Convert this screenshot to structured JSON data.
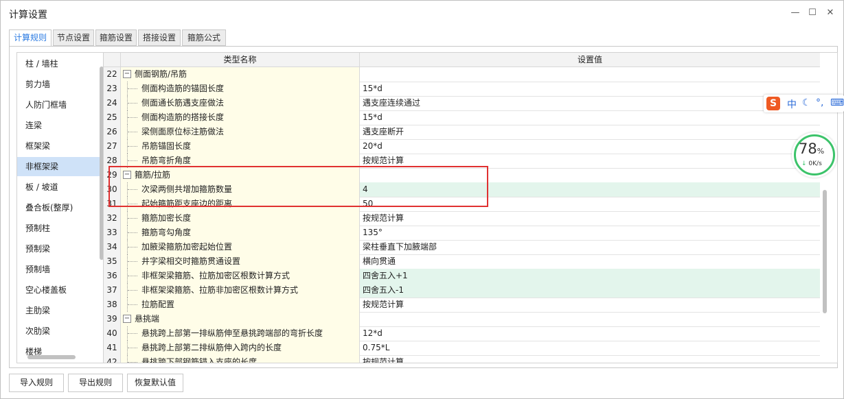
{
  "window": {
    "title": "计算设置",
    "controls": {
      "minimize": "—",
      "maximize": "☐",
      "close": "✕"
    }
  },
  "tabs": [
    {
      "label": "计算规则",
      "active": true
    },
    {
      "label": "节点设置",
      "active": false
    },
    {
      "label": "箍筋设置",
      "active": false
    },
    {
      "label": "搭接设置",
      "active": false
    },
    {
      "label": "箍筋公式",
      "active": false
    }
  ],
  "sidebar": {
    "items": [
      {
        "label": "柱 / 墙柱"
      },
      {
        "label": "剪力墙"
      },
      {
        "label": "人防门框墙"
      },
      {
        "label": "连梁"
      },
      {
        "label": "框架梁"
      },
      {
        "label": "非框架梁",
        "selected": true
      },
      {
        "label": "板 / 坡道"
      },
      {
        "label": "叠合板(整厚)"
      },
      {
        "label": "预制柱"
      },
      {
        "label": "预制梁"
      },
      {
        "label": "预制墙"
      },
      {
        "label": "空心楼盖板"
      },
      {
        "label": "主肋梁"
      },
      {
        "label": "次肋梁"
      },
      {
        "label": "楼梯"
      }
    ]
  },
  "grid": {
    "headers": {
      "name": "类型名称",
      "value": "设置值"
    },
    "rows": [
      {
        "num": "22",
        "name": "侧面钢筋/吊筋",
        "value": "",
        "group": true
      },
      {
        "num": "23",
        "name": "侧面构造筋的锚固长度",
        "value": "15*d"
      },
      {
        "num": "24",
        "name": "侧面通长筋遇支座做法",
        "value": "遇支座连续通过"
      },
      {
        "num": "25",
        "name": "侧面构造筋的搭接长度",
        "value": "15*d"
      },
      {
        "num": "26",
        "name": "梁侧面原位标注筋做法",
        "value": "遇支座断开"
      },
      {
        "num": "27",
        "name": "吊筋锚固长度",
        "value": "20*d"
      },
      {
        "num": "28",
        "name": "吊筋弯折角度",
        "value": "按规范计算"
      },
      {
        "num": "29",
        "name": "箍筋/拉筋",
        "value": "",
        "group": true
      },
      {
        "num": "30",
        "name": "次梁两侧共增加箍筋数量",
        "value": "4",
        "highlight": true
      },
      {
        "num": "31",
        "name": "起始箍筋距支座边的距离",
        "value": "50"
      },
      {
        "num": "32",
        "name": "箍筋加密长度",
        "value": "按规范计算"
      },
      {
        "num": "33",
        "name": "箍筋弯勾角度",
        "value": "135°"
      },
      {
        "num": "34",
        "name": "加腋梁箍筋加密起始位置",
        "value": "梁柱垂直下加腋端部"
      },
      {
        "num": "35",
        "name": "井字梁相交时箍筋贯通设置",
        "value": "横向贯通"
      },
      {
        "num": "36",
        "name": "非框架梁箍筋、拉筋加密区根数计算方式",
        "value": "四舍五入+1",
        "highlight": true
      },
      {
        "num": "37",
        "name": "非框架梁箍筋、拉筋非加密区根数计算方式",
        "value": "四舍五入-1",
        "highlight": true
      },
      {
        "num": "38",
        "name": "拉筋配置",
        "value": "按规范计算"
      },
      {
        "num": "39",
        "name": "悬挑端",
        "value": "",
        "group": true
      },
      {
        "num": "40",
        "name": "悬挑跨上部第一排纵筋伸至悬挑跨端部的弯折长度",
        "value": "12*d"
      },
      {
        "num": "41",
        "name": "悬挑跨上部第二排纵筋伸入跨内的长度",
        "value": "0.75*L"
      },
      {
        "num": "42",
        "name": "悬挑跨下部钢筋锚入支座的长度",
        "value": "按规范计算"
      }
    ]
  },
  "buttons": {
    "import": "导入规则",
    "export": "导出规则",
    "restore": "恢复默认值"
  },
  "ime": {
    "logo": "S",
    "mode": "中",
    "moon": "☾",
    "punct": "°,",
    "keyboard": "⌨"
  },
  "speed_widget": {
    "percent": "78",
    "percent_sign": "%",
    "rate": "0K/s",
    "arrow": "↓"
  }
}
